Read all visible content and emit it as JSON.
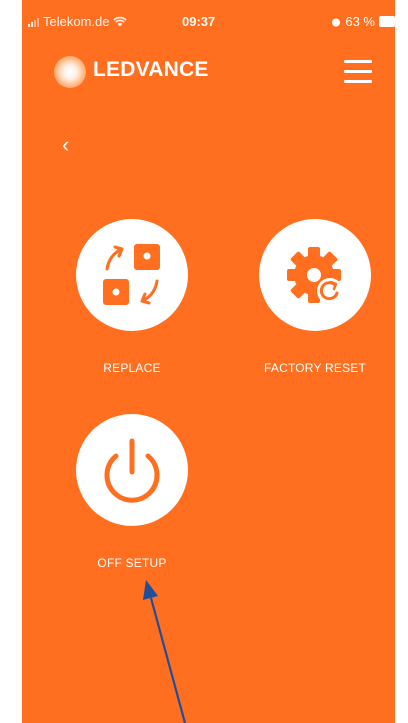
{
  "status_bar": {
    "carrier": "Telekom.de",
    "time": "09:37",
    "battery": "63 %"
  },
  "header": {
    "brand": "LEDVANCE",
    "logo_icon": "ledvance-logo-icon",
    "menu_icon": "hamburger-menu-icon"
  },
  "navigation": {
    "back_icon": "chevron-left-icon",
    "back_glyph": "‹"
  },
  "actions": [
    {
      "label": "REPLACE",
      "icon": "replace-icon"
    },
    {
      "label": "FACTORY RESET",
      "icon": "gear-reset-icon"
    },
    {
      "label": "OFF SETUP",
      "icon": "power-icon"
    }
  ],
  "colors": {
    "background": "#ff6f1f",
    "tile": "#ffffff",
    "icon": "#ff6f1f",
    "annotation_arrow": "#1f4e9a"
  }
}
